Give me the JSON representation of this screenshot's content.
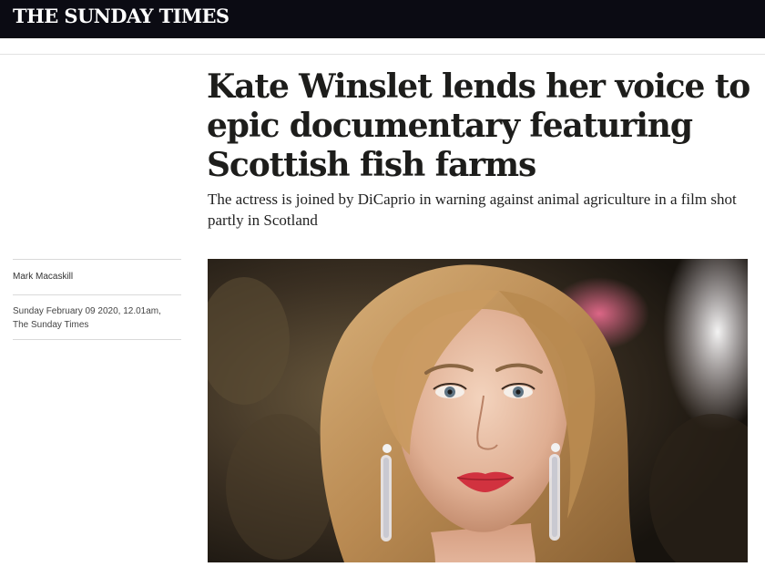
{
  "masthead": {
    "title": "THE SUNDAY TIMES"
  },
  "article": {
    "headline": "Kate Winslet lends her voice to epic documentary featuring Scottish fish farms",
    "standfirst": "The actress is joined by DiCaprio in warning against animal agriculture in a film shot partly in Scotland",
    "author": "Mark Macaskill",
    "date": "Sunday February 09 2020, 12.01am,",
    "publication": "The Sunday Times"
  },
  "colors": {
    "masthead_bg": "#0b0b13",
    "text": "#1d1d1b",
    "rule": "#d9d9d9"
  }
}
